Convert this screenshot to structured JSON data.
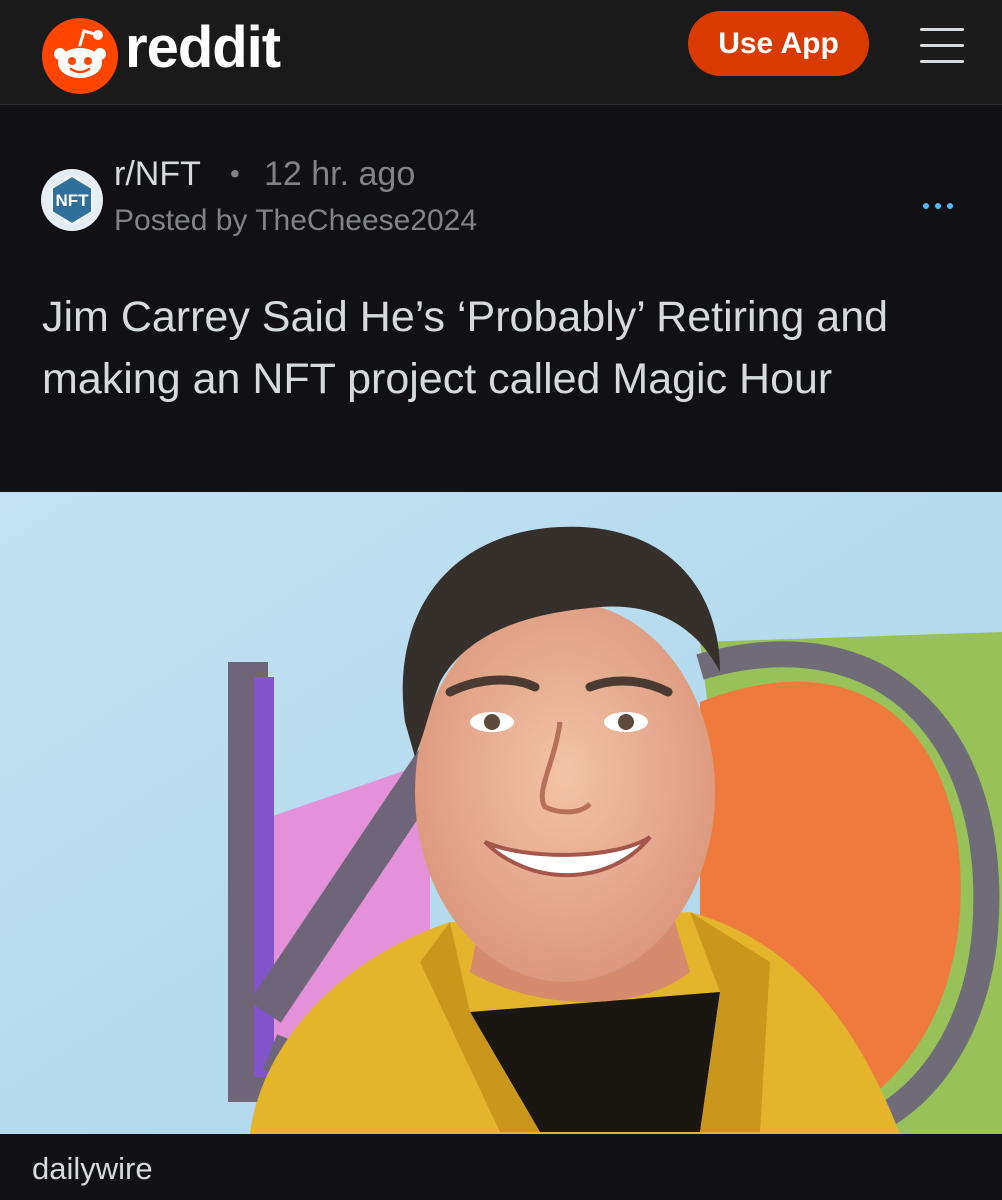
{
  "header": {
    "logo_text": "reddit",
    "use_app_label": "Use App",
    "logo_color": "#ff4500",
    "button_color": "#d93a00"
  },
  "post": {
    "subreddit": "r/NFT",
    "separator": "•",
    "time": "12 hr. ago",
    "posted_by": "Posted by TheCheese2024",
    "subreddit_icon_text": "NFT",
    "title": "Jim Carrey Said He’s ‘Probably’ Retiring and making an NFT project called Magic Hour",
    "more_icon": "ellipsis-icon"
  },
  "image": {
    "alt": "Smiling man with dark swept-back hair in a yellow jacket in front of a colorful backdrop"
  },
  "source": {
    "label": "dailywire"
  }
}
